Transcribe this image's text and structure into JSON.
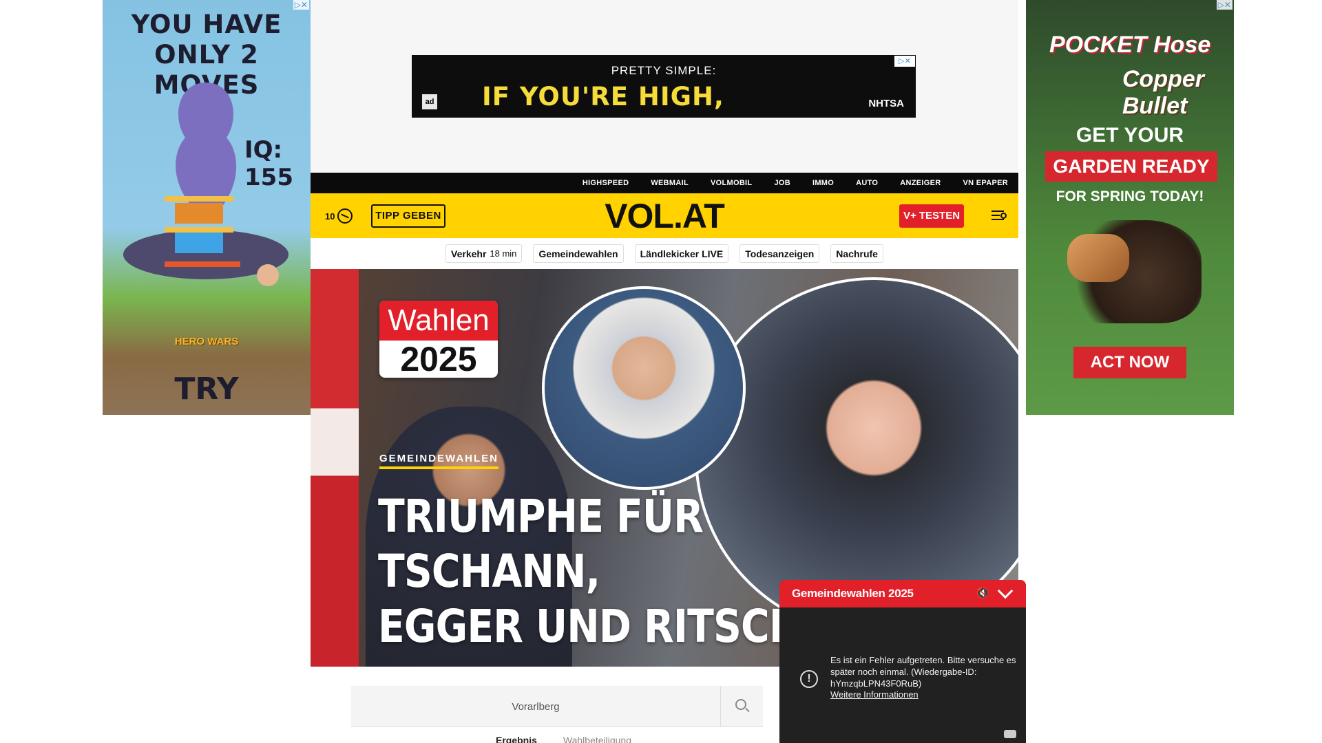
{
  "ads": {
    "left": {
      "title_line1": "YOU HAVE",
      "title_line2": "ONLY 2 MOVES",
      "iq": "IQ: 155",
      "brand": "HERO WARS",
      "cta": "TRY"
    },
    "top": {
      "headline_small": "PRETTY SIMPLE:",
      "headline_big": "IF YOU'RE HIGH,",
      "ad_logo": "ad",
      "sponsor": "NHTSA"
    },
    "right": {
      "logo_line1": "POCKET Hose",
      "logo_line2": "Copper Bullet",
      "line1": "GET YOUR",
      "line2": "GARDEN READY",
      "line3": "FOR SPRING TODAY!",
      "cta": "ACT NOW"
    }
  },
  "topnav": {
    "items": [
      "HIGHSPEED",
      "WEBMAIL",
      "VOLMOBIL",
      "JOB",
      "IMMO",
      "AUTO",
      "ANZEIGER",
      "VN EPAPER"
    ]
  },
  "header": {
    "temperature": "10",
    "tipp_label": "TIPP GEBEN",
    "logo": "VOL.AT",
    "vplus_label": "V+ TESTEN"
  },
  "subnav": {
    "verkehr_label": "Verkehr",
    "verkehr_time": "18 min",
    "items": [
      "Gemeindewahlen",
      "Ländlekicker LIVE",
      "Todesanzeigen",
      "Nachrufe"
    ]
  },
  "hero": {
    "badge_top": "Wahlen",
    "badge_bottom": "2025",
    "kicker": "GEMEINDEWAHLEN",
    "headline_line1": "TRIUMPHE FÜR TSCHANN,",
    "headline_line2": "EGGER UND RITSCH"
  },
  "search": {
    "value": "Vorarlberg"
  },
  "results_tabs": [
    "Ergebnis",
    "Wahlbeteiligung"
  ],
  "video_popup": {
    "title": "Gemeindewahlen 2025",
    "error_text": "Es ist ein Fehler aufgetreten. Bitte versuche es später noch einmal. (Wiedergabe-ID: hYmzqbLPN43F0RuB)",
    "more_link": "Weitere Informationen"
  },
  "colors": {
    "brand_yellow": "#ffd200",
    "brand_red": "#e2202a",
    "topnav_bg": "#0b0b0b"
  }
}
